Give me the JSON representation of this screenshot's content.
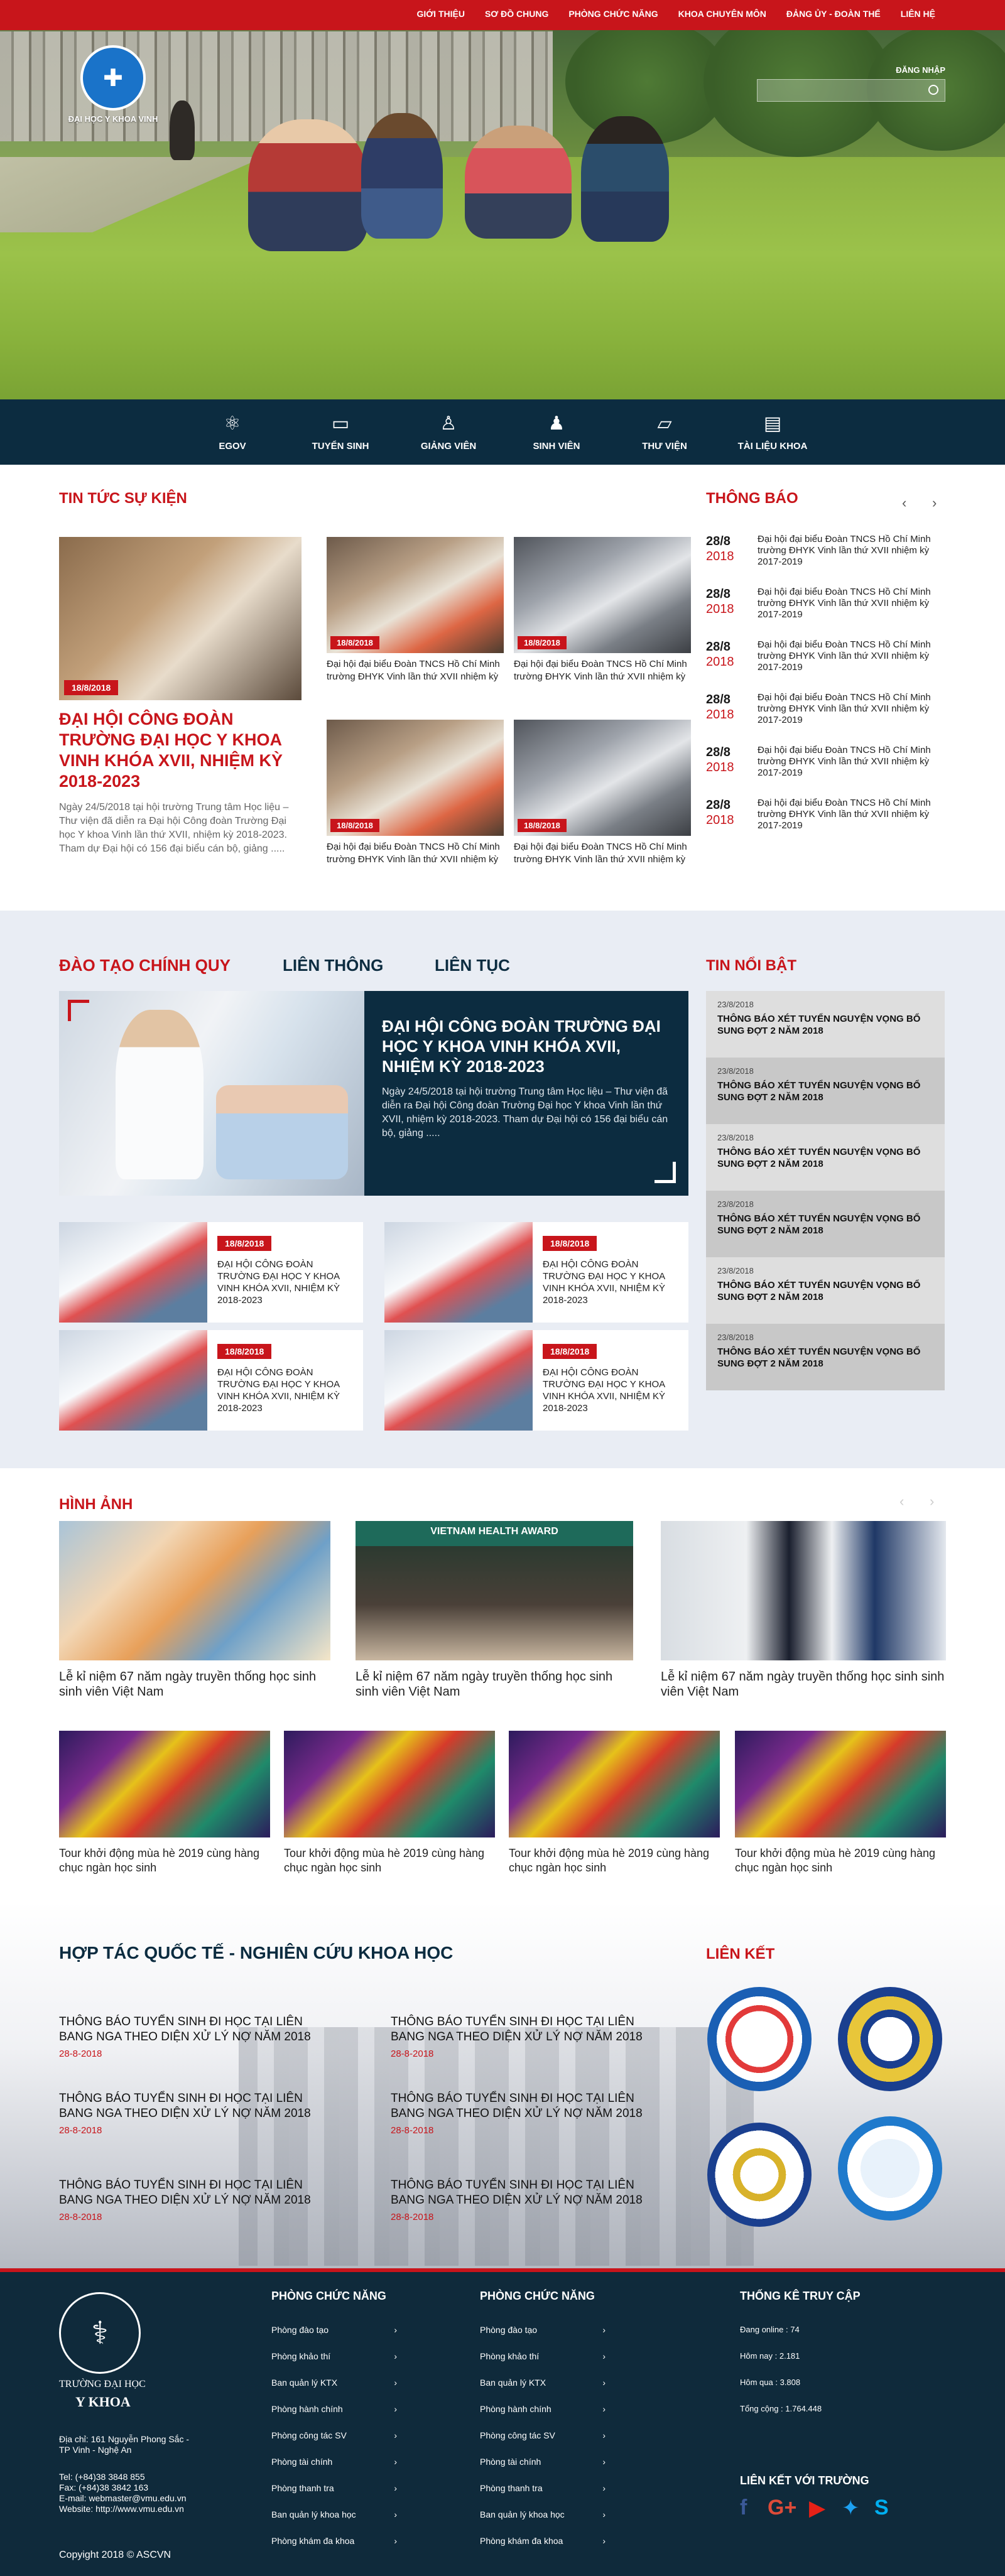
{
  "nav": {
    "items": [
      "GIỚI THIỆU",
      "SƠ ĐỒ CHUNG",
      "PHÒNG CHỨC NĂNG",
      "KHOA CHUYÊN MÔN",
      "ĐẢNG ỦY - ĐOÀN THỂ",
      "LIÊN HỆ"
    ],
    "login": "ĐĂNG NHẬP",
    "search_placeholder": ""
  },
  "logo": {
    "text": "ĐẠI HỌC Y KHOA VINH"
  },
  "quick_menu": [
    {
      "label": "EGOV",
      "icon": "atom-icon"
    },
    {
      "label": "TUYỂN SINH",
      "icon": "admission-icon"
    },
    {
      "label": "GIẢNG VIÊN",
      "icon": "teacher-icon"
    },
    {
      "label": "SINH VIÊN",
      "icon": "student-icon"
    },
    {
      "label": "THƯ VIỆN",
      "icon": "library-icon"
    },
    {
      "label": "TÀI LIỆU KHOA",
      "icon": "document-icon"
    }
  ],
  "news": {
    "title": "TIN TỨC SỰ KIỆN",
    "featured": {
      "date": "18/8/2018",
      "title": "ĐẠI HỘI CÔNG ĐOÀN TRƯỜNG ĐẠI HỌC Y KHOA VINH KHÓA XVII, NHIỆM KỲ 2018-2023",
      "summary": "Ngày 24/5/2018 tại hội trường Trung tâm Học liệu – Thư viện đã diễn ra Đại hội Công đoàn Trường Đại học Y khoa Vinh lần thứ XVII, nhiệm kỳ 2018-2023. Tham dự Đại hội có 156 đại biểu cán bộ, giảng ....."
    },
    "cards": [
      {
        "date": "18/8/2018",
        "title": "Đại hội đại biểu Đoàn TNCS Hồ Chí Minh trường ĐHYK Vinh lần thứ XVII nhiệm kỳ"
      },
      {
        "date": "18/8/2018",
        "title": "Đại hội đại biểu Đoàn TNCS Hồ Chí Minh trường ĐHYK Vinh lần thứ XVII nhiệm kỳ"
      },
      {
        "date": "18/8/2018",
        "title": "Đại hội đại biểu Đoàn TNCS Hồ Chí Minh trường ĐHYK Vinh lần thứ XVII nhiệm kỳ"
      },
      {
        "date": "18/8/2018",
        "title": "Đại hội đại biểu Đoàn TNCS Hồ Chí Minh trường ĐHYK Vinh lần thứ XVII nhiệm kỳ"
      }
    ]
  },
  "notices": {
    "title": "THÔNG BÁO",
    "items": [
      {
        "day": "28/8",
        "year": "2018",
        "text": "Đại hội đại biểu Đoàn TNCS Hồ Chí Minh trường ĐHYK Vinh lần thứ XVII nhiệm kỳ 2017-2019"
      },
      {
        "day": "28/8",
        "year": "2018",
        "text": "Đại hội đại biểu Đoàn TNCS Hồ Chí Minh trường ĐHYK Vinh lần thứ XVII nhiệm kỳ 2017-2019"
      },
      {
        "day": "28/8",
        "year": "2018",
        "text": "Đại hội đại biểu Đoàn TNCS Hồ Chí Minh trường ĐHYK Vinh lần thứ XVII nhiệm kỳ 2017-2019"
      },
      {
        "day": "28/8",
        "year": "2018",
        "text": "Đại hội đại biểu Đoàn TNCS Hồ Chí Minh trường ĐHYK Vinh lần thứ XVII nhiệm kỳ 2017-2019"
      },
      {
        "day": "28/8",
        "year": "2018",
        "text": "Đại hội đại biểu Đoàn TNCS Hồ Chí Minh trường ĐHYK Vinh lần thứ XVII nhiệm kỳ 2017-2019"
      },
      {
        "day": "28/8",
        "year": "2018",
        "text": "Đại hội đại biểu Đoàn TNCS Hồ Chí Minh trường ĐHYK Vinh lần thứ XVII nhiệm kỳ 2017-2019"
      }
    ]
  },
  "training": {
    "tabs": [
      "ĐÀO TẠO CHÍNH QUY",
      "LIÊN THÔNG",
      "LIÊN TỤC"
    ],
    "featured": {
      "title": "ĐẠI HỘI CÔNG ĐOÀN TRƯỜNG ĐẠI HỌC Y KHOA VINH KHÓA XVII, NHIỆM KỲ 2018-2023",
      "summary": "Ngày 24/5/2018 tại hội trường Trung tâm Học liệu – Thư viện đã diễn ra Đại hội Công đoàn Trường Đại học Y khoa Vinh lần thứ XVII, nhiệm kỳ 2018-2023. Tham dự Đại hội có 156 đại biểu cán bộ, giảng ....."
    },
    "cards": [
      {
        "date": "18/8/2018",
        "title": "ĐẠI HỘI CÔNG ĐOÀN TRƯỜNG ĐẠI HỌC Y KHOA VINH KHÓA XVII, NHIỆM KỲ 2018-2023"
      },
      {
        "date": "18/8/2018",
        "title": "ĐẠI HỘI CÔNG ĐOÀN TRƯỜNG ĐẠI HỌC Y KHOA VINH KHÓA XVII, NHIỆM KỲ 2018-2023"
      },
      {
        "date": "18/8/2018",
        "title": "ĐẠI HỘI CÔNG ĐOÀN TRƯỜNG ĐẠI HỌC Y KHOA VINH KHÓA XVII, NHIỆM KỲ 2018-2023"
      },
      {
        "date": "18/8/2018",
        "title": "ĐẠI HỘI CÔNG ĐOÀN TRƯỜNG ĐẠI HỌC Y KHOA VINH KHÓA XVII, NHIỆM KỲ 2018-2023"
      }
    ]
  },
  "hot_news": {
    "title": "TIN NỔI BẬT",
    "items": [
      {
        "date": "23/8/2018",
        "title": "THÔNG BÁO XÉT TUYỂN NGUYỆN VỌNG BỔ SUNG  ĐỢT 2 NĂM 2018"
      },
      {
        "date": "23/8/2018",
        "title": "THÔNG BÁO XÉT TUYỂN NGUYỆN VỌNG BỔ SUNG  ĐỢT 2 NĂM 2018"
      },
      {
        "date": "23/8/2018",
        "title": "THÔNG BÁO XÉT TUYỂN NGUYỆN VỌNG BỔ SUNG  ĐỢT 2 NĂM 2018"
      },
      {
        "date": "23/8/2018",
        "title": "THÔNG BÁO XÉT TUYỂN NGUYỆN VỌNG BỔ SUNG  ĐỢT 2 NĂM 2018"
      },
      {
        "date": "23/8/2018",
        "title": "THÔNG BÁO XÉT TUYỂN NGUYỆN VỌNG BỔ SUNG  ĐỢT 2 NĂM 2018"
      },
      {
        "date": "23/8/2018",
        "title": "THÔNG BÁO XÉT TUYỂN NGUYỆN VỌNG BỔ SUNG  ĐỢT 2 NĂM 2018"
      }
    ]
  },
  "gallery": {
    "title": "HÌNH ẢNH",
    "big": [
      "Lễ kỉ niệm 67 năm ngày truyền thống học sinh sinh viên Việt Nam",
      "Lễ kỉ niệm 67 năm ngày truyền thống học sinh sinh viên Việt Nam",
      "Lễ kỉ niệm 67 năm ngày truyền thống học sinh sinh viên Việt Nam"
    ],
    "award_text": "VIETNAM HEALTH AWARD",
    "small": [
      "Tour khởi động mùa hè 2019 cùng hàng chục ngàn học sinh",
      "Tour khởi động mùa hè 2019 cùng hàng chục ngàn học sinh",
      "Tour khởi động mùa hè 2019 cùng hàng chục ngàn học sinh",
      "Tour khởi động mùa hè 2019 cùng hàng chục ngàn học sinh"
    ]
  },
  "coop": {
    "title": "HỢP TÁC QUỐC TẾ - NGHIÊN CỨU KHOA HỌC",
    "items": [
      {
        "title": "THÔNG BÁO TUYỂN SINH ĐI HỌC TẠI LIÊN BANG NGA THEO DIỆN XỬ LÝ NỢ NĂM 2018",
        "date": "28-8-2018"
      },
      {
        "title": "THÔNG BÁO TUYỂN SINH ĐI HỌC TẠI LIÊN BANG NGA THEO DIỆN XỬ LÝ NỢ NĂM 2018",
        "date": "28-8-2018"
      },
      {
        "title": "THÔNG BÁO TUYỂN SINH ĐI HỌC TẠI LIÊN BANG NGA THEO DIỆN XỬ LÝ NỢ NĂM 2018",
        "date": "28-8-2018"
      },
      {
        "title": "THÔNG BÁO TUYỂN SINH ĐI HỌC TẠI LIÊN BANG NGA THEO DIỆN XỬ LÝ NỢ NĂM 2018",
        "date": "28-8-2018"
      },
      {
        "title": "THÔNG BÁO TUYỂN SINH ĐI HỌC TẠI LIÊN BANG NGA THEO DIỆN XỬ LÝ NỢ NĂM 2018",
        "date": "28-8-2018"
      },
      {
        "title": "THÔNG BÁO TUYỂN SINH ĐI HỌC TẠI LIÊN BANG NGA THEO DIỆN XỬ LÝ NỢ NĂM 2018",
        "date": "28-8-2018"
      }
    ],
    "links_title": "LIÊN KẾT"
  },
  "footer": {
    "logo_line1": "TRƯỜNG ĐẠI HỌC",
    "logo_line2": "Y KHOA",
    "address": "Địa chỉ: 161 Nguyễn Phong Sắc - TP Vinh - Nghệ An",
    "phone": "Tel: (+84)38 3848 855",
    "fax": "Fax: (+84)38 3842 163",
    "email": "E-mail: webmaster@vmu.edu.vn",
    "website": "Website: http://www.vmu.edu.vn",
    "col1_title": "PHÒNG CHỨC NĂNG",
    "col2_title": "PHÒNG CHỨC NĂNG",
    "links": [
      "Phòng đào tạo",
      "Phòng khảo thí",
      "Ban quản lý KTX",
      "Phòng hành chính",
      "Phòng công tác SV",
      "Phòng tài chính",
      "Phòng thanh tra",
      "Ban quản lý khoa học",
      "Phòng khám đa khoa"
    ],
    "stats_title": "THỐNG KÊ TRUY CẬP",
    "stats": [
      "Đang online : 74",
      "Hôm nay : 2.181",
      "Hôm qua : 3.808",
      "Tổng cộng : 1.764.448"
    ],
    "social_title": "LIÊN KẾT VỚI TRƯỜNG",
    "copyright": "Copyight  2018 © ASCVN"
  }
}
